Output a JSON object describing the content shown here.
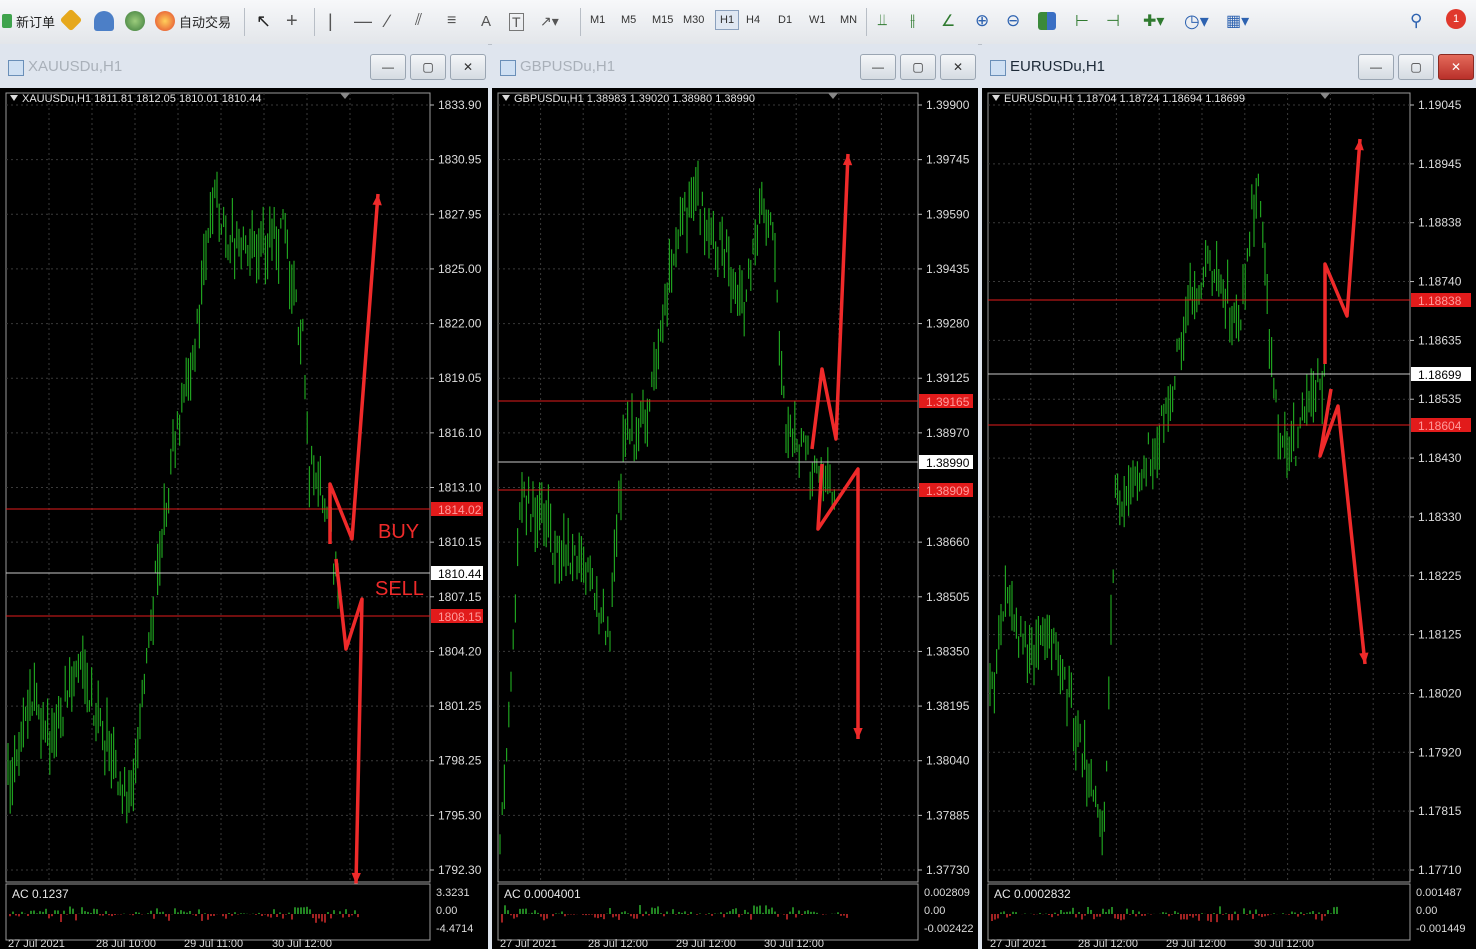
{
  "toolbar": {
    "new_order_label": "新订单",
    "auto_trade_label": "自动交易",
    "timeframes": [
      "M1",
      "M5",
      "M15",
      "M30",
      "H1",
      "H4",
      "D1",
      "W1",
      "MN"
    ],
    "selected_timeframe": "H1",
    "notification_count": "1"
  },
  "charts": [
    {
      "id": "xau",
      "window_title": "XAUUSDu,H1",
      "active": false,
      "header": "XAUUSDu,H1  1811.81 1812.05 1810.01 1810.44",
      "price_ticks": [
        "1833.90",
        "1830.95",
        "1827.95",
        "1825.00",
        "1822.00",
        "1819.05",
        "1816.10",
        "1813.10",
        "1810.15",
        "1807.15",
        "1804.20",
        "1801.25",
        "1798.25",
        "1795.30",
        "1792.30"
      ],
      "price_labels": [
        {
          "text": "1814.02",
          "color": "#e21b1b"
        },
        {
          "text": "1810.44",
          "color": "#ffffff"
        },
        {
          "text": "1808.15",
          "color": "#e21b1b"
        }
      ],
      "annotations": [
        "BUY",
        "SELL"
      ],
      "indicator_label": "AC 0.1237",
      "indicator_ticks": [
        "3.3231",
        "0.00",
        "-4.4714"
      ],
      "date_labels": [
        "27 Jul 2021",
        "28 Jul 10:00",
        "29 Jul 11:00",
        "30 Jul 12:00"
      ]
    },
    {
      "id": "gbp",
      "window_title": "GBPUSDu,H1",
      "active": false,
      "header": "GBPUSDu,H1  1.38983 1.39020 1.38980 1.38990",
      "price_ticks": [
        "1.39900",
        "1.39745",
        "1.39590",
        "1.39435",
        "1.39280",
        "1.39125",
        "1.38970",
        "1.38815",
        "1.38660",
        "1.38505",
        "1.38350",
        "1.38195",
        "1.38040",
        "1.37885",
        "1.37730"
      ],
      "price_labels": [
        {
          "text": "1.39165",
          "color": "#e21b1b"
        },
        {
          "text": "1.38990",
          "color": "#ffffff"
        },
        {
          "text": "1.38909",
          "color": "#e21b1b"
        }
      ],
      "annotations": [],
      "indicator_label": "AC 0.0004001",
      "indicator_ticks": [
        "0.002809",
        "0.00",
        "-0.002422"
      ],
      "date_labels": [
        "27 Jul 2021",
        "28 Jul 12:00",
        "29 Jul 12:00",
        "30 Jul 12:00"
      ]
    },
    {
      "id": "eur",
      "window_title": "EURUSDu,H1",
      "active": true,
      "header": "EURUSDu,H1  1.18704 1.18724 1.18694 1.18699",
      "price_ticks": [
        "1.19045",
        "1.18945",
        "1.18838",
        "1.18740",
        "1.18635",
        "1.18535",
        "1.18430",
        "1.18330",
        "1.18225",
        "1.18125",
        "1.18020",
        "1.17920",
        "1.17815",
        "1.17710"
      ],
      "price_labels": [
        {
          "text": "1.18838",
          "color": "#e21b1b"
        },
        {
          "text": "1.18699",
          "color": "#ffffff"
        },
        {
          "text": "1.18604",
          "color": "#e21b1b"
        }
      ],
      "annotations": [],
      "indicator_label": "AC 0.0002832",
      "indicator_ticks": [
        "0.001487",
        "0.00",
        "-0.001449"
      ],
      "date_labels": [
        "27 Jul 2021",
        "28 Jul 12:00",
        "29 Jul 12:00",
        "30 Jul 12:00"
      ]
    }
  ],
  "colors": {
    "candle": "#1fa01f",
    "grid": "#3a3a3a",
    "level": "#e21b1b",
    "current": "#c8c8c8",
    "arrow": "#ef2a2a"
  }
}
